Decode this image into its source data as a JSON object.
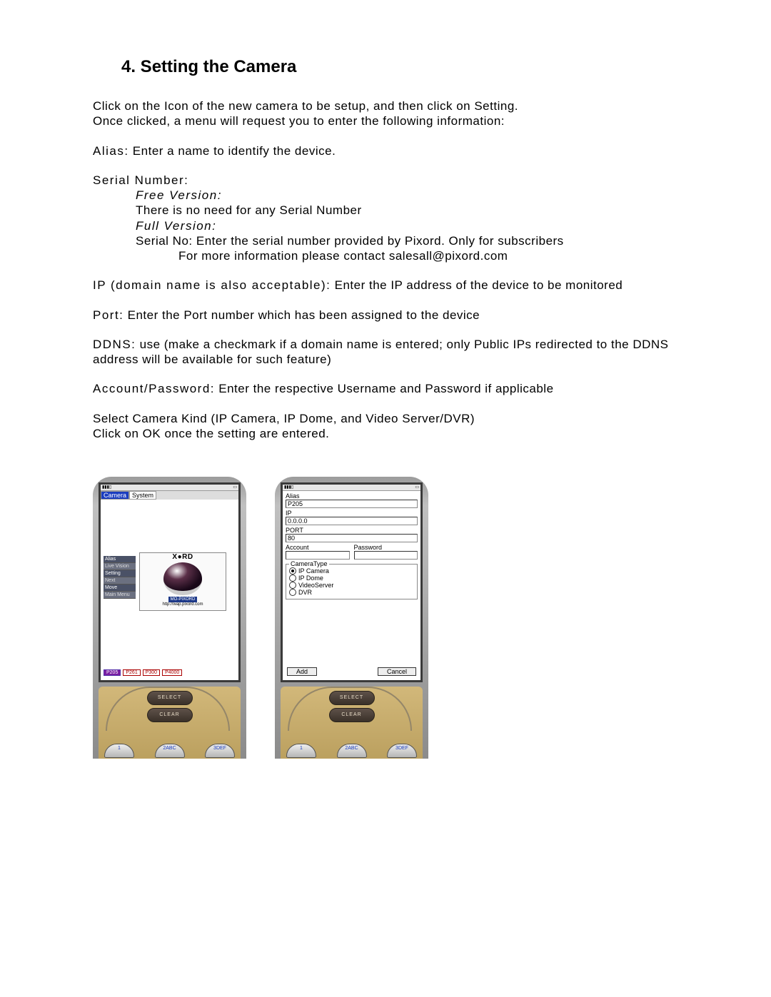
{
  "heading": "4. Setting the Camera",
  "intro1": "Click on the Icon of the new camera to be setup, and then click on Setting.",
  "intro2": "Once clicked, a menu will request you to enter the following information:",
  "alias_label": "Alias:",
  "alias_desc": " Enter a name to identify the device.",
  "serial_label": "Serial Number:",
  "free_version": "Free Version:",
  "free_version_desc": "There is no need for any Serial Number",
  "full_version": "Full Version:",
  "full_version_l1": "Serial No: Enter the serial number provided by Pixord. Only for subscribers",
  "full_version_l2": "For more information please contact salesall@pixord.com",
  "ip_label": "IP (domain name is also acceptable):",
  "ip_desc": " Enter the IP address of the device to be monitored",
  "port_label": "Port:",
  "port_desc": " Enter the Port number which has been assigned to the device",
  "ddns_label": "DDNS:",
  "ddns_desc": " use (make a checkmark if a domain name is entered; only Public IPs redirected to the DDNS address will be available for such feature)",
  "acct_label": "Account/Password:",
  "acct_desc": " Enter the respective Username and Password if applicable",
  "select_kind": "Select Camera Kind (IP Camera, IP Dome, and Video Server/DVR)",
  "click_ok": "Click on OK once the setting are entered.",
  "phone1": {
    "tabs": {
      "camera": "Camera",
      "system": "System"
    },
    "menu": [
      "Alias",
      "Live Vision",
      "Setting",
      "Next",
      "Move",
      "Main Menu"
    ],
    "tiles": {
      "p205": "P205",
      "p261": "P261",
      "p300": "P300",
      "p4000": "P4000"
    },
    "promo_logo": "X●RD",
    "promo_tag": "MO-PIXORD",
    "promo_url": "http://wap.pixord.com"
  },
  "phone2": {
    "labels": {
      "alias": "Alias",
      "ip": "IP",
      "port": "PORT",
      "account": "Account",
      "password": "Password",
      "camtype": "CameraType"
    },
    "values": {
      "alias": "P205",
      "ip": "0.0.0.0",
      "port": "80",
      "account": "",
      "password": ""
    },
    "radios": {
      "ipcam": "IP Camera",
      "ipdome": "IP Dome",
      "videoserver": "VideoServer",
      "dvr": "DVR"
    },
    "buttons": {
      "add": "Add",
      "cancel": "Cancel"
    }
  },
  "keypad": {
    "select": "SELECT",
    "clear": "CLEAR",
    "k1": "1",
    "k2": "2ABC",
    "k3": "3DEF"
  }
}
